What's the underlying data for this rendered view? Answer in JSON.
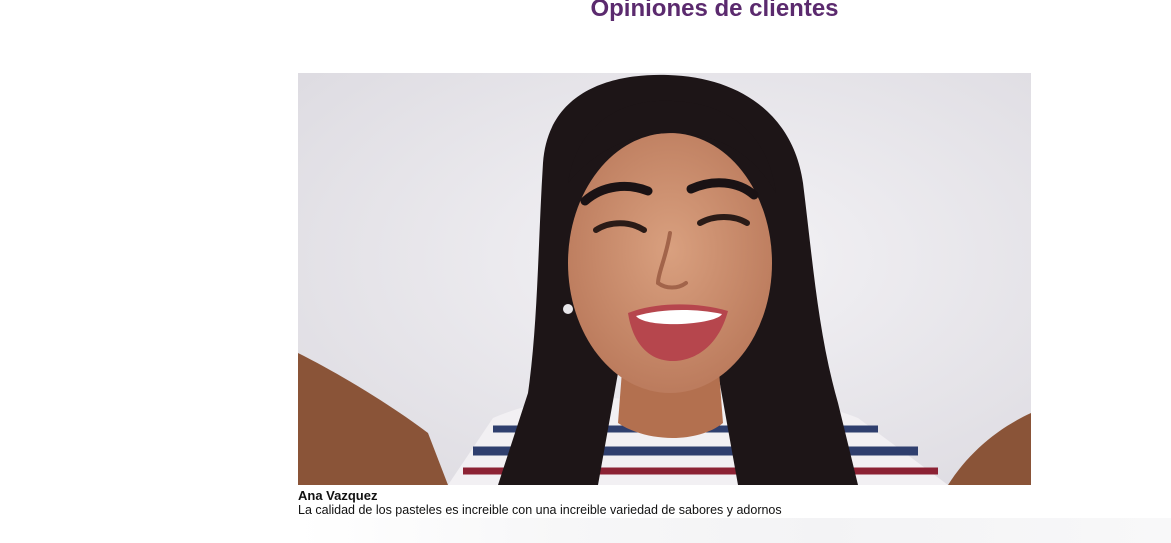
{
  "section": {
    "title": "Opiniones de clientes"
  },
  "testimonial": {
    "photo_icon": "customer-photo",
    "author": "Ana Vazquez",
    "quote": "La calidad de los pasteles es increible con una increible variedad de sabores y adornos"
  },
  "colors": {
    "title": "#5b2a6e",
    "text": "#111111",
    "background": "#ffffff",
    "photo_background": "#ecebef"
  }
}
